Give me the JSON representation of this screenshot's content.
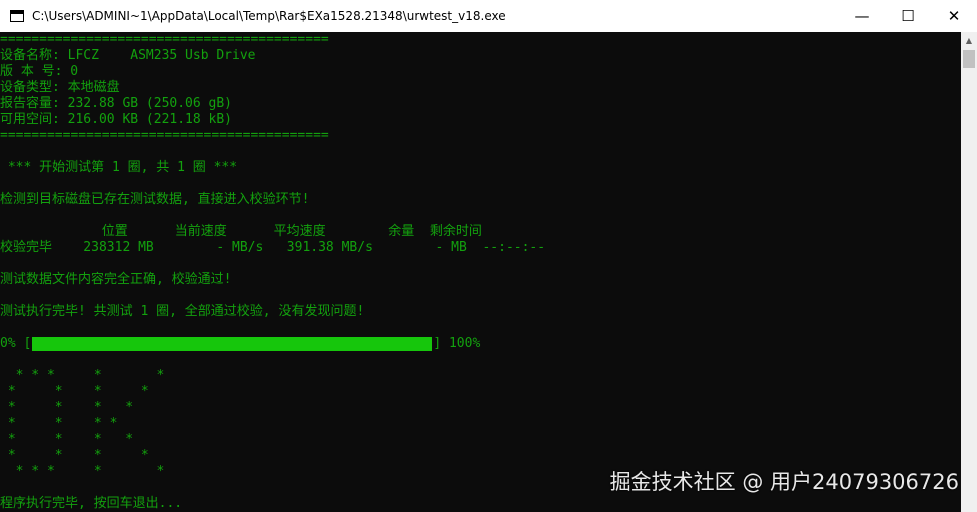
{
  "window": {
    "title": "C:\\Users\\ADMINI~1\\AppData\\Local\\Temp\\Rar$EXa1528.21348\\urwtest_v18.exe",
    "minimize_glyph": "—",
    "maximize_glyph": "☐",
    "close_glyph": "✕"
  },
  "console": {
    "separator_top": "==========================================",
    "device_name": "设备名称: LFCZ    ASM235 Usb Drive",
    "version": "版 本 号: 0",
    "device_type": "设备类型: 本地磁盘",
    "reported_capacity": "报告容量: 232.88 GB (250.06 gB)",
    "free_space": "可用空间: 216.00 KB (221.18 kB)",
    "separator_bottom": "==========================================",
    "round_start": " *** 开始测试第 1 圈, 共 1 圈 ***",
    "existing_data_msg": "检测到目标磁盘已存在测试数据, 直接进入校验环节!",
    "table_header": "             位置      当前速度      平均速度        余量  剩余时间",
    "table_row": "校验完毕    238312 MB        - MB/s   391.38 MB/s        - MB  --:--:--",
    "verify_ok_msg": "测试数据文件内容完全正确, 校验通过!",
    "done_msg": "测试执行完毕! 共测试 1 圈, 全部通过校验, 没有发现问题!",
    "progress_left": "0% [",
    "progress_right": "] 100%",
    "progress_fraction": 1.0,
    "ok_art": [
      "  * * *     *       *",
      " *     *    *     *",
      " *     *    *   *",
      " *     *    * *",
      " *     *    *   *",
      " *     *    *     *",
      "  * * *     *       *"
    ],
    "exit_msg": "程序执行完毕, 按回车退出..."
  },
  "watermark": "掘金技术社区 @ 用户24079306726",
  "colors": {
    "console_bg": "#0c0c0c",
    "console_text": "#13a10e",
    "progress_fill": "#16c60c"
  }
}
